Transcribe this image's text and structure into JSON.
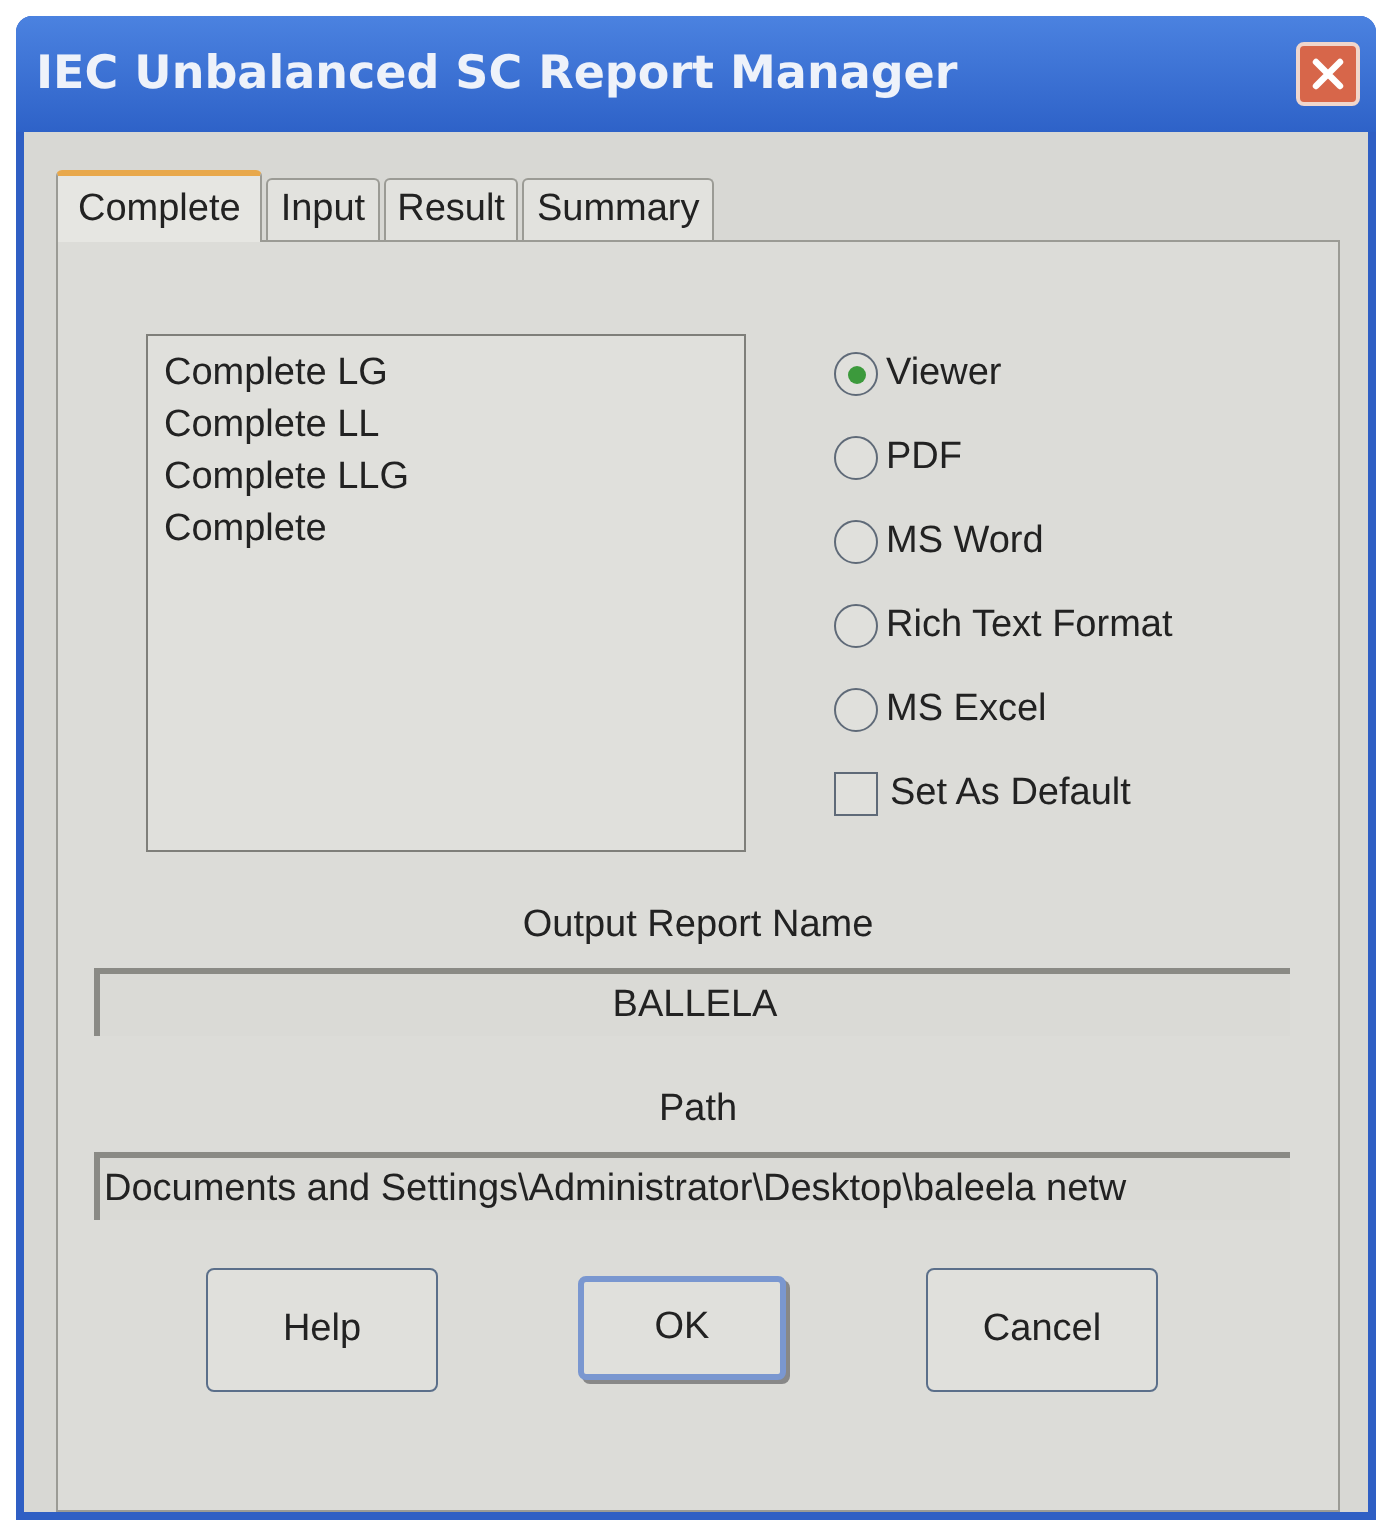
{
  "window": {
    "title": "IEC Unbalanced SC Report Manager"
  },
  "tabs": [
    {
      "label": "Complete",
      "selected": true
    },
    {
      "label": "Input",
      "selected": false
    },
    {
      "label": "Result",
      "selected": false
    },
    {
      "label": "Summary",
      "selected": false
    }
  ],
  "report_list": [
    "Complete LG",
    "Complete LL",
    "Complete LLG",
    "Complete"
  ],
  "output_options": [
    {
      "kind": "radio",
      "label": "Viewer",
      "selected": true
    },
    {
      "kind": "radio",
      "label": "PDF",
      "selected": false
    },
    {
      "kind": "radio",
      "label": "MS Word",
      "selected": false
    },
    {
      "kind": "radio",
      "label": "Rich Text Format",
      "selected": false
    },
    {
      "kind": "radio",
      "label": "MS Excel",
      "selected": false
    },
    {
      "kind": "checkbox",
      "label": "Set As Default",
      "checked": false
    }
  ],
  "output_report_name": {
    "label": "Output Report Name",
    "value": "BALLELA"
  },
  "path": {
    "label": "Path",
    "value": "Documents and Settings\\Administrator\\Desktop\\baleela netw"
  },
  "buttons": [
    {
      "label": "Help",
      "default": false
    },
    {
      "label": "OK",
      "default": true
    },
    {
      "label": "Cancel",
      "default": false
    }
  ]
}
